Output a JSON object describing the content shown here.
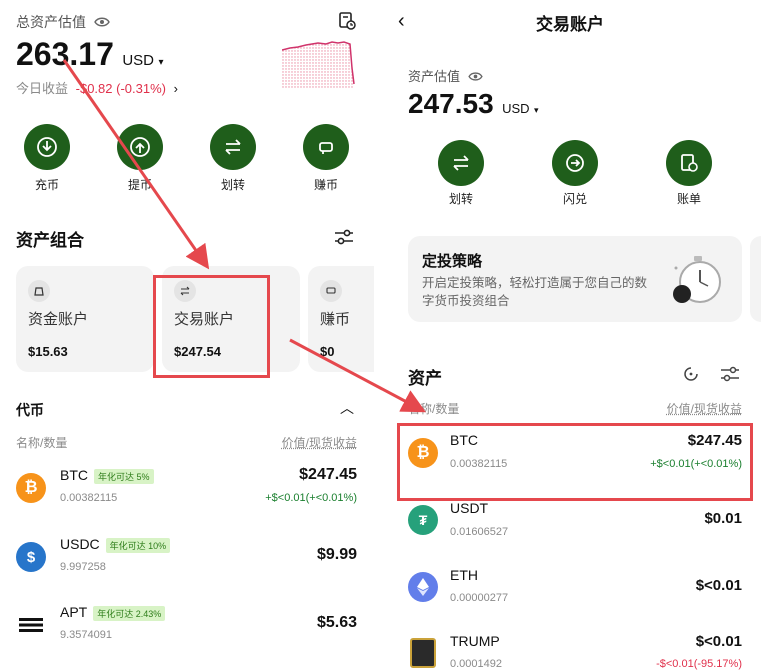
{
  "left": {
    "total_label": "总资产估值",
    "total_value": "263.17",
    "currency": "USD",
    "today_label": "今日收益",
    "today_value": "-$0.82 (-0.31%)",
    "actions": [
      {
        "label": "充币"
      },
      {
        "label": "提币"
      },
      {
        "label": "划转"
      },
      {
        "label": "赚币"
      }
    ],
    "portfolio_title": "资产组合",
    "accounts": [
      {
        "name": "资金账户",
        "value": "$15.63"
      },
      {
        "name": "交易账户",
        "value": "$247.54"
      },
      {
        "name": "赚币",
        "value": "$0"
      }
    ],
    "tokens_title": "代币",
    "col_name": "名称/数量",
    "col_value": "价值/现货收益",
    "tokens": [
      {
        "symbol": "BTC",
        "badge": "年化可达 5%",
        "qty": "0.00382115",
        "value": "$247.45",
        "pnl": "+$<0.01(+<0.01%)"
      },
      {
        "symbol": "USDC",
        "badge": "年化可达 10%",
        "qty": "9.997258",
        "value": "$9.99",
        "pnl": ""
      },
      {
        "symbol": "APT",
        "badge": "年化可达 2.43%",
        "qty": "9.3574091",
        "value": "$5.63",
        "pnl": ""
      }
    ]
  },
  "right": {
    "title": "交易账户",
    "est_label": "资产估值",
    "est_value": "247.53",
    "currency": "USD",
    "actions": [
      {
        "label": "划转"
      },
      {
        "label": "闪兑"
      },
      {
        "label": "账单"
      }
    ],
    "promo_title": "定投策略",
    "promo_desc": "开启定投策略，轻松打造属于您自己的数字货币投资组合",
    "assets_title": "资产",
    "col_name": "名称/数量",
    "col_value": "价值/现货收益",
    "assets": [
      {
        "symbol": "BTC",
        "qty": "0.00382115",
        "value": "$247.45",
        "pnl": "+$<0.01(+<0.01%)"
      },
      {
        "symbol": "USDT",
        "qty": "0.01606527",
        "value": "$0.01",
        "pnl": ""
      },
      {
        "symbol": "ETH",
        "qty": "0.00000277",
        "value": "$<0.01",
        "pnl": ""
      },
      {
        "symbol": "TRUMP",
        "qty": "0.0001492",
        "value": "$<0.01",
        "pnl": "-$<0.01(-95.17%)"
      }
    ]
  },
  "colors": {
    "accent_green": "#1f5e1b",
    "annotation_red": "#e5484d",
    "btc_orange": "#f7931a",
    "usdc_blue": "#2775ca",
    "usdt_teal": "#26a17b",
    "eth_blue": "#627eea"
  }
}
